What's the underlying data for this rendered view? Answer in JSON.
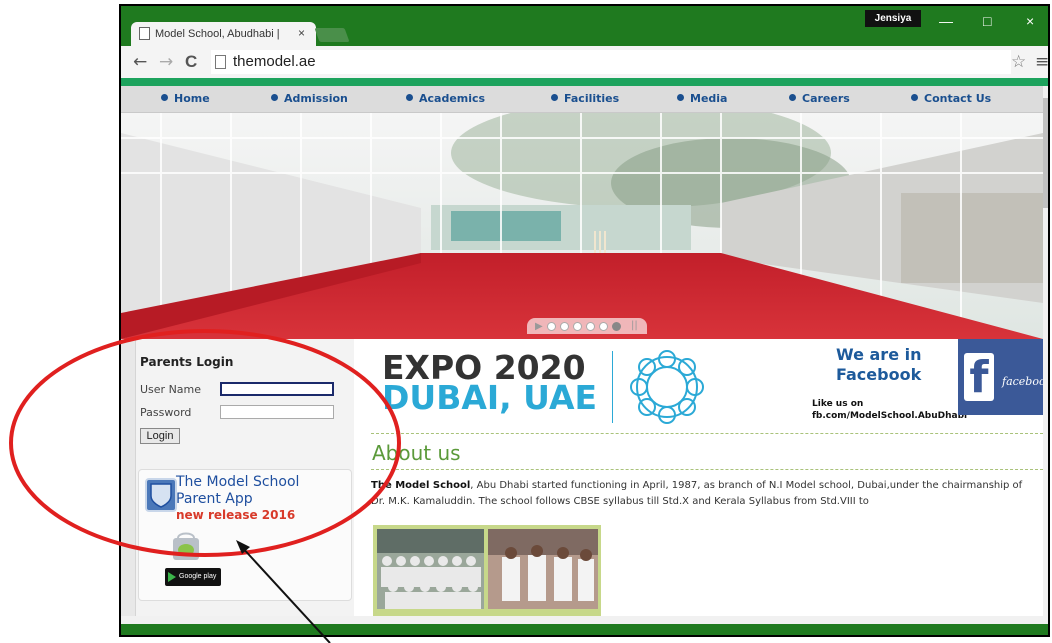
{
  "browser": {
    "tab_title": "Model School, Abudhabi |",
    "tab_close": "×",
    "profile_name": "Jensiya",
    "window_controls": {
      "minimize": "—",
      "maximize": "□",
      "close": "×"
    },
    "nav": {
      "back": "←",
      "forward": "→",
      "reload": "C"
    },
    "url": "themodel.ae",
    "star": "☆",
    "menu": "≡"
  },
  "site": {
    "nav_items": [
      "Home",
      "Admission",
      "Academics",
      "Facilities",
      "Media",
      "Careers",
      "Contact Us"
    ],
    "slider_play": "▶",
    "slider_pause": "||",
    "slider_dot_count": 6,
    "slider_active_index": 5,
    "parents_login": {
      "title": "Parents Login",
      "user_label": "User Name",
      "user_value": "",
      "password_label": "Password",
      "password_value": "",
      "login_button": "Login"
    },
    "app_promo": {
      "line1": "The Model School",
      "line2": "Parent App",
      "line3": "new release 2016",
      "store_badge": "Google play"
    },
    "expo": {
      "line1": "EXPO 2020",
      "line2": "DUBAI, UAE"
    },
    "facebook": {
      "heading1": "We are in",
      "heading2": "Facebook",
      "like_line": "Like us on",
      "link": "fb.com/ModelSchool.AbuDhabi",
      "badge_f": "f",
      "badge_word": "faceboo"
    },
    "about": {
      "heading": "About us",
      "bold_lead": "The Model School",
      "paragraph": ", Abu Dhabi started functioning in April, 1987, as branch of N.I Model school, Dubai,under the chairmanship of Dr. M.K. Kamaluddin. The school follows CBSE syllabus till Std.X and Kerala Syllabus from Std.VIII to"
    }
  },
  "colors": {
    "chrome_green": "#1f7a1f",
    "accent_green": "#1da35d",
    "nav_blue": "#1a4f8f",
    "expo_blue": "#2ba9d6",
    "facebook_blue": "#3b5998",
    "annotation_red": "#e0201f"
  }
}
